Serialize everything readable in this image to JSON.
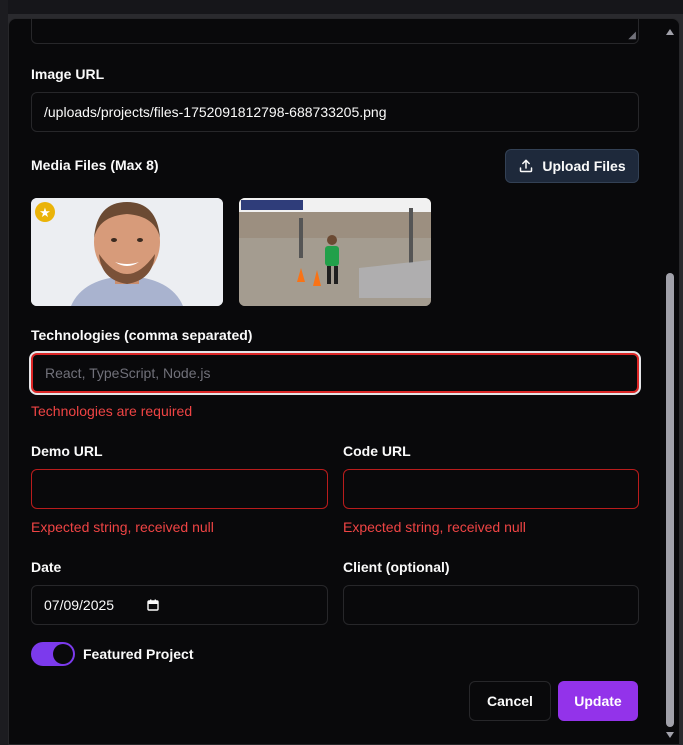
{
  "form": {
    "image_url": {
      "label": "Image URL",
      "value": "/uploads/projects/files-1752091812798-688733205.png"
    },
    "media": {
      "label": "Media Files (Max 8)",
      "upload_label": "Upload Files",
      "items": [
        {
          "kind": "portrait-photo",
          "featured": true
        },
        {
          "kind": "race-photo",
          "featured": false
        }
      ]
    },
    "technologies": {
      "label": "Technologies (comma separated)",
      "placeholder": "React, TypeScript, Node.js",
      "error": "Technologies are required"
    },
    "demo_url": {
      "label": "Demo URL",
      "value": "",
      "error": "Expected string, received null"
    },
    "code_url": {
      "label": "Code URL",
      "value": "",
      "error": "Expected string, received null"
    },
    "date": {
      "label": "Date",
      "value": "07/09/2025"
    },
    "client": {
      "label": "Client (optional)",
      "value": ""
    },
    "featured": {
      "label": "Featured Project",
      "checked": true
    },
    "actions": {
      "cancel": "Cancel",
      "update": "Update"
    }
  },
  "colors": {
    "accent": "#9333ea",
    "error": "#ef4444",
    "background": "#09090b",
    "star": "#eab308"
  },
  "icons": [
    "upload-icon",
    "star-icon",
    "calendar-icon",
    "resize-grip-icon"
  ]
}
